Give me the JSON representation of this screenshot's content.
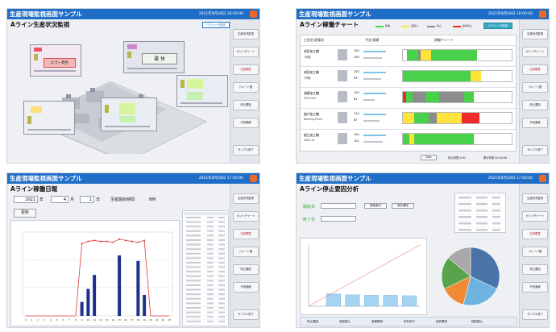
{
  "panels": {
    "status": {
      "app_title": "生産現場監視画面サンプル",
      "timestamp": "2021年8月28日 18:00:00",
      "page_title": "Aライン生産状況監視",
      "top_button": "パラメータ設定",
      "status_labels": {
        "error": "エラー発生",
        "stopped": "運 休"
      },
      "sidebar": [
        "生産状況監視",
        "ガントチャート",
        "生産履歴",
        "パレート図",
        "停止要因",
        "不良実績",
        "サンプル終了"
      ]
    },
    "gantt": {
      "app_title": "生産現場監視画面サンプル",
      "timestamp": "2021年8月28日 18:00:00",
      "page_title": "Aライン稼働チャート",
      "legend": [
        "稼働",
        "段取り",
        "停止",
        "異常停止"
      ],
      "top_button": "パラメータ設定",
      "headers": {
        "process": "工程名/設備名",
        "plan": "予定/実績",
        "chart": "稼働チャート"
      },
      "rows": [
        {
          "name": "成形加工機",
          "sub": "1号機",
          "plan": "120",
          "act": "100",
          "segments": [
            [
              "#ffffff",
              0.04
            ],
            [
              "#48d14a",
              0.1
            ],
            [
              "#8c8c8c",
              0.02
            ],
            [
              "#ffe23a",
              0.1
            ],
            [
              "#48d14a",
              0.42
            ],
            [
              "#ffffff",
              0.32
            ]
          ]
        },
        {
          "name": "成形加工機",
          "sub": "2号機",
          "plan": "120",
          "act": "93",
          "segments": [
            [
              "#48d14a",
              0.62
            ],
            [
              "#ffe23a",
              0.1
            ],
            [
              "#ffffff",
              0.28
            ]
          ]
        },
        {
          "name": "溶接加工機",
          "sub": "E33-A201",
          "plan": "120",
          "act": "61",
          "segments": [
            [
              "#ef2a2a",
              0.03
            ],
            [
              "#48d14a",
              0.06
            ],
            [
              "#8c8c8c",
              0.12
            ],
            [
              "#48d14a",
              0.12
            ],
            [
              "#8c8c8c",
              0.23
            ],
            [
              "#48d14a",
              0.09
            ],
            [
              "#ffffff",
              0.35
            ]
          ]
        },
        {
          "name": "曲げ加工機",
          "sub": "Bending-M103",
          "plan": "120",
          "act": "87",
          "segments": [
            [
              "#ffe23a",
              0.1
            ],
            [
              "#48d14a",
              0.14
            ],
            [
              "#8c8c8c",
              0.07
            ],
            [
              "#ffe23a",
              0.23
            ],
            [
              "#ef2a2a",
              0.16
            ],
            [
              "#ffffff",
              0.3
            ]
          ]
        },
        {
          "name": "組立加工機",
          "sub": "CAS1-01",
          "plan": "120",
          "act": "101",
          "segments": [
            [
              "#48d14a",
              0.06
            ],
            [
              "#ffe23a",
              0.04
            ],
            [
              "#48d14a",
              0.55
            ],
            [
              "#ffffff",
              0.35
            ]
          ]
        }
      ],
      "footer": {
        "button": "Bike",
        "summary1": "停止時間 0:00",
        "summary2": "累計時間 00:00:00"
      },
      "sidebar": [
        "生産状況監視",
        "ガントチャート",
        "生産履歴",
        "パレート図",
        "停止要因",
        "不良実績",
        "サンプル終了"
      ]
    },
    "daily": {
      "app_title": "生産現場監視画面サンプル",
      "timestamp": "2021年8月28日 17:00:00",
      "page_title": "Aライン稼働日報",
      "year": "2021",
      "year_unit": "年",
      "month": "4",
      "month_unit": "月",
      "day": "1",
      "day_unit": "日",
      "start_label": "生産開始時間",
      "start_value": "8時",
      "update_button": "更新",
      "sidebar": [
        "生産状況監視",
        "ガントチャート",
        "生産履歴",
        "パレート図",
        "停止要因",
        "不良実績",
        "サンプル終了"
      ]
    },
    "stop": {
      "app_title": "生産現場監視画面サンプル",
      "timestamp": "2021年8月28日 17:00:00",
      "page_title": "Aライン停止要因分析",
      "start_label": "開始日",
      "end_label": "終了日",
      "search_button": "検索実行",
      "reset_button": "条件解除",
      "reasons": [
        "停止要因",
        "段取替え",
        "設備異常",
        "材料待ち",
        "品質異常",
        "段取替え"
      ],
      "sidebar": [
        "生産状況監視",
        "ガントチャート",
        "生産履歴",
        "パレート図",
        "停止要因",
        "不良実績",
        "サンプル終了"
      ]
    }
  },
  "chart_data": [
    {
      "type": "bar",
      "categories": [
        "0",
        "1",
        "2",
        "3",
        "4",
        "5",
        "6",
        "7",
        "8",
        "9",
        "10",
        "11",
        "12",
        "13",
        "14",
        "15",
        "16",
        "17",
        "18",
        "19",
        "20",
        "21",
        "22",
        "23"
      ],
      "series": [
        {
          "values": [
            0,
            0,
            0,
            0,
            0,
            0,
            0,
            0,
            0,
            30,
            58,
            88,
            0,
            0,
            0,
            130,
            0,
            0,
            118,
            45,
            0,
            0,
            0,
            0
          ]
        },
        {
          "values": [
            0,
            0,
            0,
            0,
            0,
            0,
            0,
            0,
            0,
            155,
            160,
            162,
            160,
            160,
            158,
            165,
            162,
            160,
            158,
            162,
            0,
            0,
            0,
            0
          ]
        }
      ],
      "ylim": [
        0,
        180
      ]
    },
    {
      "type": "bar",
      "categories": [
        "1",
        "2",
        "3",
        "4",
        "5"
      ],
      "values": [
        28,
        26,
        25,
        25,
        24
      ],
      "ylim": [
        0,
        140
      ]
    },
    {
      "type": "pie",
      "values": [
        32,
        22,
        14,
        18,
        14
      ],
      "colors": [
        "#4a74a8",
        "#6fb4e0",
        "#f08a34",
        "#59a34c",
        "#a9a9a9"
      ]
    }
  ]
}
